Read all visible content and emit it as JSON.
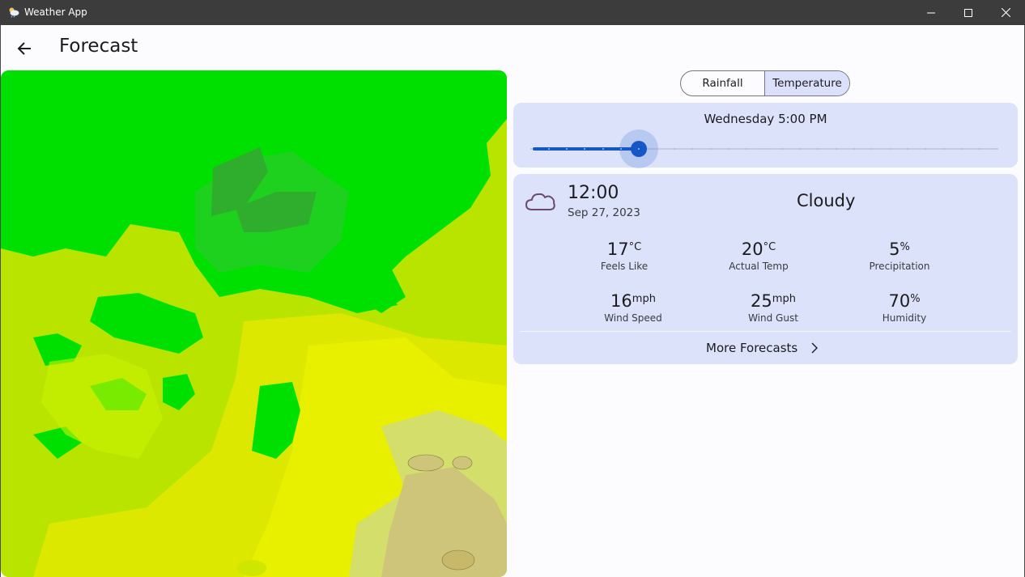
{
  "window": {
    "title": "Weather App",
    "app_icon": "weather-cloud-sun-icon"
  },
  "header": {
    "back_icon": "arrow-left-icon",
    "title": "Forecast"
  },
  "layer_toggle": {
    "options": [
      "Rainfall",
      "Temperature"
    ],
    "selected": "Temperature"
  },
  "time_slider": {
    "label": "Wednesday 5:00 PM",
    "step_count": 27,
    "selected_step": 6
  },
  "forecast": {
    "icon": "cloud-icon",
    "time": "12:00",
    "date": "Sep 27, 2023",
    "condition": "Cloudy",
    "metrics": [
      {
        "value": "17",
        "unit": "°C",
        "label": "Feels Like"
      },
      {
        "value": "20",
        "unit": "°C",
        "label": "Actual Temp"
      },
      {
        "value": "5",
        "unit": "%",
        "label": "Precipitation"
      },
      {
        "value": "16",
        "unit": "mph",
        "label": "Wind Speed"
      },
      {
        "value": "25",
        "unit": "mph",
        "label": "Wind Gust"
      },
      {
        "value": "70",
        "unit": "%",
        "label": "Humidity"
      }
    ],
    "more_label": "More Forecasts",
    "more_icon": "chevron-right-icon"
  },
  "colors": {
    "accent": "#1557c7",
    "card_bg": "#dbe2fa",
    "map_dark_green": "#2fae2d",
    "map_green": "#00e000",
    "map_yellow_green": "#b8e400",
    "map_yellow": "#e0e800",
    "map_tan": "#d2cc72"
  }
}
